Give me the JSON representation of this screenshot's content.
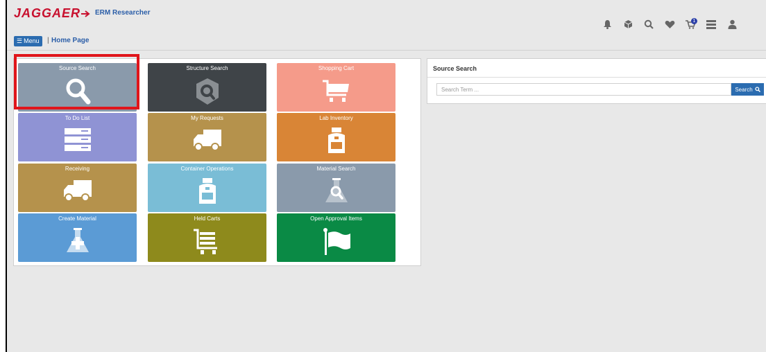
{
  "header": {
    "logo_text": "JAGGAER",
    "app_name": "ERM Researcher",
    "menu_label": "Menu",
    "separator": "|",
    "breadcrumb": "Home Page",
    "cart_count": "1",
    "icons": [
      "bell-icon",
      "cube-icon",
      "search-icon",
      "heart-icon",
      "cart-icon",
      "list-icon",
      "user-icon"
    ]
  },
  "tiles": [
    {
      "label": "Source Search",
      "icon": "search-icon",
      "color": "#8a9aab"
    },
    {
      "label": "Structure Search",
      "icon": "structure-icon",
      "color": "#3f4448"
    },
    {
      "label": "Shopping Cart",
      "icon": "cart-icon",
      "color": "#f59b8a"
    },
    {
      "label": "To Do List",
      "icon": "list-icon",
      "color": "#8f93d4"
    },
    {
      "label": "My Requests",
      "icon": "truck-icon",
      "color": "#b5924c"
    },
    {
      "label": "Lab Inventory",
      "icon": "bottle-icon",
      "color": "#d98536"
    },
    {
      "label": "Receiving",
      "icon": "truck-icon",
      "color": "#b5924c"
    },
    {
      "label": "Container Operations",
      "icon": "bottle-icon",
      "color": "#7abdd6"
    },
    {
      "label": "Material Search",
      "icon": "flask-search-icon",
      "color": "#8a9aab"
    },
    {
      "label": "Create Material",
      "icon": "flask-plus-icon",
      "color": "#5b9bd5"
    },
    {
      "label": "Held Carts",
      "icon": "cart-list-icon",
      "color": "#8e8a1c"
    },
    {
      "label": "Open Approval Items",
      "icon": "flag-icon",
      "color": "#0a8a45"
    }
  ],
  "source_search": {
    "title": "Source Search",
    "placeholder": "Search Term ...",
    "button_label": "Search"
  },
  "colors": {
    "accent": "#2b6cb0",
    "brand": "#c8102e",
    "highlight": "#e0151b"
  }
}
